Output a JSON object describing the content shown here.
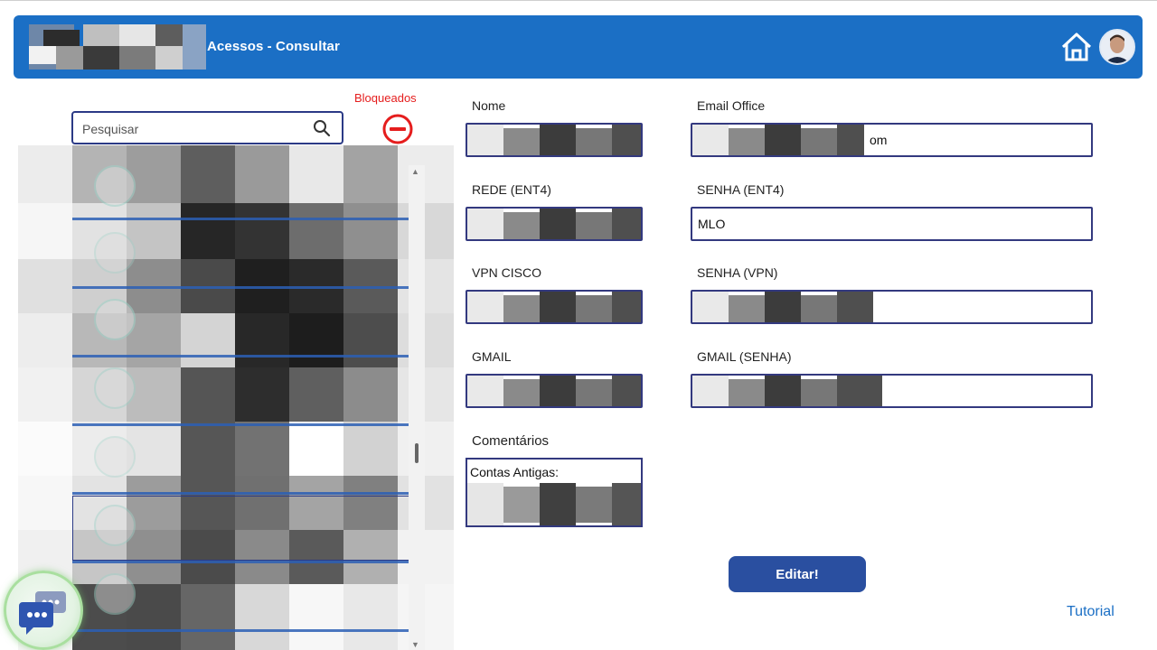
{
  "header": {
    "title": "Acessos - Consultar",
    "bg_color": "#1b6fc5"
  },
  "sidebar": {
    "search_placeholder": "Pesquisar",
    "blocked_label": "Bloqueados",
    "blocked_color": "#e51d1d"
  },
  "form": {
    "nome_label": "Nome",
    "email_label": "Email Office",
    "email_visible_suffix": "om",
    "rede_label": "REDE (ENT4)",
    "senha_ent4_label": "SENHA (ENT4)",
    "senha_ent4_value": "MLO",
    "vpn_label": "VPN CISCO",
    "senha_vpn_label": "SENHA (VPN)",
    "gmail_label": "GMAIL",
    "gmail_senha_label": "GMAIL (SENHA)",
    "comments_label": "Comentários",
    "comments_value": "Contas Antigas:"
  },
  "actions": {
    "edit_label": "Editar!",
    "tutorial_label": "Tutorial"
  },
  "icons": {
    "home": "home-icon",
    "search": "search-icon",
    "blocked": "minus-circle-icon",
    "chat": "chat-icon"
  },
  "colors": {
    "accent": "#2a4fa0",
    "field_border": "#33397f"
  }
}
